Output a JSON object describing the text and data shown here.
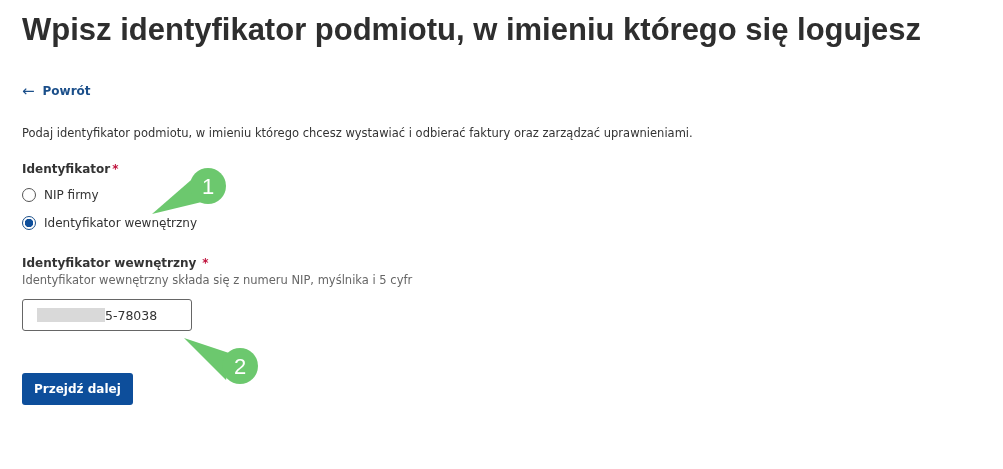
{
  "title": "Wpisz identyfikator podmiotu, w imieniu którego się logujesz",
  "back_link": {
    "icon": "←",
    "label": "Powrót"
  },
  "description": "Podaj identyfikator podmiotu, w imieniu którego chcesz wystawiać i odbierać faktury oraz zarządzać uprawnieniami.",
  "identifier_group": {
    "label": "Identyfikator",
    "required_mark": "*",
    "options": [
      {
        "label": "NIP firmy",
        "selected": false
      },
      {
        "label": "Identyfikator wewnętrzny",
        "selected": true
      }
    ]
  },
  "internal_id_field": {
    "label": "Identyfikator wewnętrzny",
    "required_mark": "*",
    "hint": "Identyfikator wewnętrzny składa się z numeru NIP, myślnika i 5 cyfr",
    "value": "5-78038",
    "redacted": true
  },
  "submit_button": {
    "label": "Przejdź dalej"
  },
  "callouts": [
    {
      "number": "1"
    },
    {
      "number": "2"
    }
  ]
}
